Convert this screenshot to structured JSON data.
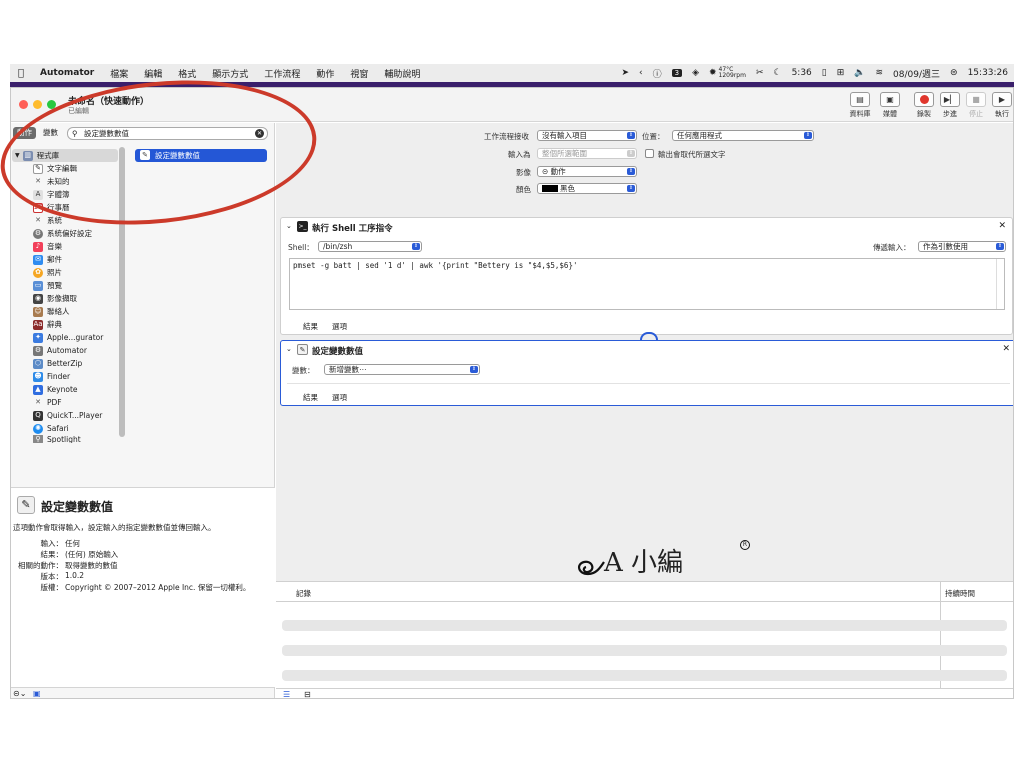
{
  "menubar": {
    "app": "Automator",
    "items": [
      "檔案",
      "編輯",
      "格式",
      "顯示方式",
      "工作流程",
      "動作",
      "視窗",
      "輔助說明"
    ],
    "status": {
      "temp": "47°C",
      "fan": "1209rpm",
      "battery_time": "5:36",
      "date": "08/09/週三",
      "time": "15:33:26",
      "badge": "3"
    }
  },
  "window": {
    "title": "未命名（快速動作）",
    "subtitle": "已編輯",
    "toolbar": [
      {
        "label": "資料庫",
        "icon": "library-icon"
      },
      {
        "label": "媒體",
        "icon": "media-icon"
      },
      {
        "label": "錄製",
        "icon": "record-icon"
      },
      {
        "label": "步進",
        "icon": "step-icon"
      },
      {
        "label": "停止",
        "icon": "stop-icon"
      },
      {
        "label": "執行",
        "icon": "run-icon"
      }
    ]
  },
  "left": {
    "tab_actions": "動作",
    "tab_variables": "變數",
    "search_value": "設定變數數值",
    "library_root": "程式庫",
    "library": [
      "文字編輯",
      "未知的",
      "字體簿",
      "行事曆",
      "系統",
      "系統偏好設定",
      "音樂",
      "郵件",
      "照片",
      "預覽",
      "影像擷取",
      "聯絡人",
      "辭典",
      "Apple...gurator",
      "Automator",
      "BetterZip",
      "Finder",
      "Keynote",
      "PDF",
      "QuickT...Player",
      "Safari",
      "Spotlight"
    ],
    "selected_action": "設定變數數值",
    "desc": {
      "title": "設定變數數值",
      "summary": "這項動作會取得輸入，設定輸入的指定變數數值並傳回輸入。",
      "rows": [
        {
          "k": "輸入：",
          "v": "任何"
        },
        {
          "k": "結果：",
          "v": "(任何) 原始輸入"
        },
        {
          "k": "相關的動作：",
          "v": "取得變數的數值"
        },
        {
          "k": "版本：",
          "v": "1.0.2"
        },
        {
          "k": "版權：",
          "v": "Copyright © 2007–2012 Apple Inc. 保留一切權利。"
        }
      ]
    }
  },
  "workflow": {
    "receives_label": "工作流程接收",
    "receives_value": "沒有輸入項目",
    "location_label": "位置：",
    "location_value": "任何應用程式",
    "input_label": "輸入為",
    "input_value": "整個所選範圍",
    "replace_label": "輸出會取代所選文字",
    "image_label": "影像",
    "image_value": "⊝ 動作",
    "color_label": "顏色",
    "color_value": "黑色"
  },
  "shell_card": {
    "title": "執行 Shell 工序指令",
    "shell_label": "Shell：",
    "shell_value": "/bin/zsh",
    "pass_label": "傳遞輸入：",
    "pass_value": "作為引數使用",
    "script": "pmset -g batt | sed '1 d' | awk '{print \"Bettery is \"$4,$5,$6}'",
    "tab_results": "結果",
    "tab_options": "選項"
  },
  "var_card": {
    "title": "設定變數數值",
    "var_label": "變數：",
    "var_value": "新增變數⋯",
    "tab_results": "結果",
    "tab_options": "選項"
  },
  "log": {
    "col_log": "記錄",
    "col_duration": "持續時間"
  },
  "watermark": {
    "text": "A 小編",
    "mark": "R"
  },
  "colors": {
    "accent": "#2a5bd7",
    "annotation": "#cc3a2a",
    "wallpaper": "#3a1f6b"
  }
}
